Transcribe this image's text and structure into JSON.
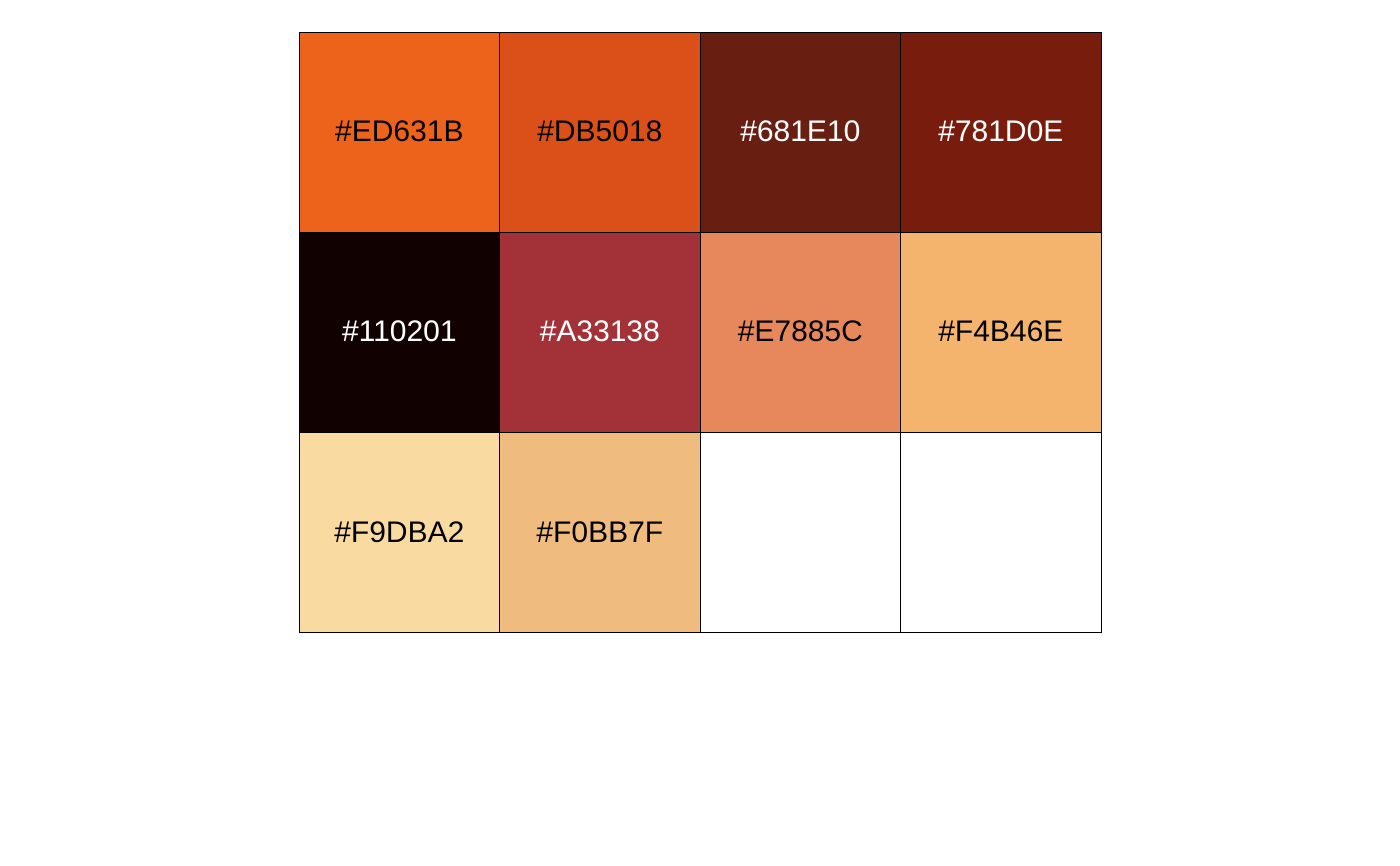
{
  "palette": {
    "swatches": [
      {
        "label": "#ED631B",
        "color": "#ED631B",
        "text_color": "#000000"
      },
      {
        "label": "#DB5018",
        "color": "#DB5018",
        "text_color": "#000000"
      },
      {
        "label": "#681E10",
        "color": "#681E10",
        "text_color": "#FFFFFF"
      },
      {
        "label": "#781D0E",
        "color": "#781D0E",
        "text_color": "#FFFFFF"
      },
      {
        "label": "#110201",
        "color": "#110201",
        "text_color": "#FFFFFF"
      },
      {
        "label": "#A33138",
        "color": "#A33138",
        "text_color": "#FFFFFF"
      },
      {
        "label": "#E7885C",
        "color": "#E7885C",
        "text_color": "#000000"
      },
      {
        "label": "#F4B46E",
        "color": "#F4B46E",
        "text_color": "#000000"
      },
      {
        "label": "#F9DBA2",
        "color": "#F9DBA2",
        "text_color": "#000000"
      },
      {
        "label": "#F0BB7F",
        "color": "#F0BB7F",
        "text_color": "#000000"
      },
      {
        "label": "",
        "color": "#FFFFFF",
        "text_color": "#000000"
      },
      {
        "label": "",
        "color": "#FFFFFF",
        "text_color": "#000000"
      }
    ]
  }
}
